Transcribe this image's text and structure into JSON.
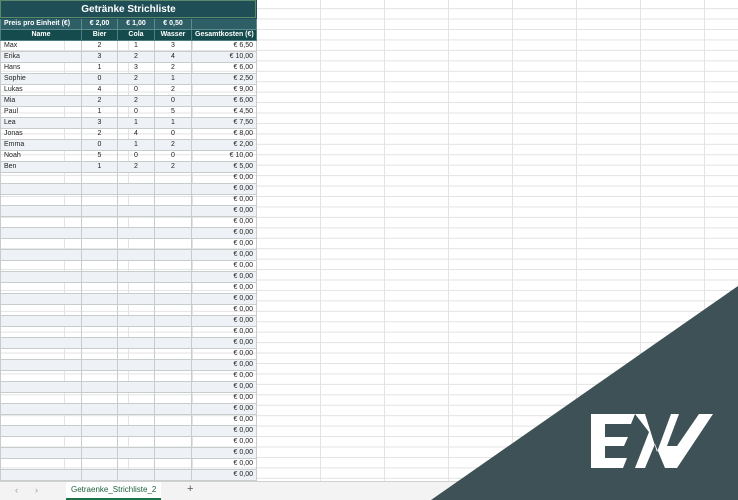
{
  "sheet": {
    "title": "Getränke Strichliste",
    "price_row": {
      "label": "Preis pro Einheit (€)",
      "bier": "€ 2,00",
      "cola": "€ 1,00",
      "wasser": "€ 0,50"
    },
    "headers": [
      "Name",
      "Bier",
      "Cola",
      "Wasser",
      "Gesamtkosten (€)"
    ],
    "rows": [
      [
        "Max",
        "2",
        "1",
        "3",
        "€ 6,50"
      ],
      [
        "Erika",
        "3",
        "2",
        "4",
        "€ 10,00"
      ],
      [
        "Hans",
        "1",
        "3",
        "2",
        "€ 6,00"
      ],
      [
        "Sophie",
        "0",
        "2",
        "1",
        "€ 2,50"
      ],
      [
        "Lukas",
        "4",
        "0",
        "2",
        "€ 9,00"
      ],
      [
        "Mia",
        "2",
        "2",
        "0",
        "€ 6,00"
      ],
      [
        "Paul",
        "1",
        "0",
        "5",
        "€ 4,50"
      ],
      [
        "Lea",
        "3",
        "1",
        "1",
        "€ 7,50"
      ],
      [
        "Jonas",
        "2",
        "4",
        "0",
        "€ 8,00"
      ],
      [
        "Emma",
        "0",
        "1",
        "2",
        "€ 2,00"
      ],
      [
        "Noah",
        "5",
        "0",
        "0",
        "€ 10,00"
      ],
      [
        "Ben",
        "1",
        "2",
        "2",
        "€ 5,00"
      ]
    ],
    "empty_total": "€ 0,00",
    "empty_row_count": 30
  },
  "tabs": {
    "nav_prev": "‹",
    "nav_next": "›",
    "active": "Getraenke_Strichliste_2",
    "add_label": "+"
  },
  "logo": {
    "text": "EW"
  },
  "colors": {
    "title_bg": "#1f4e57",
    "header_bg": "#164b4d",
    "deco": "#3d5157"
  }
}
